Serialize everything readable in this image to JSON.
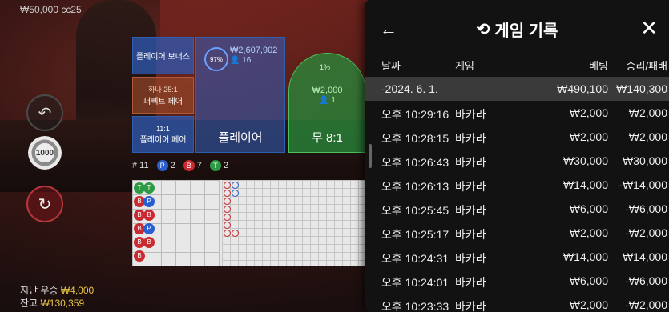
{
  "balance_top": "₩50,000 cc25",
  "chip_value": "1000",
  "bets": {
    "bonus_label": "플레이어 보너스",
    "perfect_line1": "하나 25:1",
    "perfect_line2": "퍼펙트 페어",
    "pair_line1": "11:1",
    "pair_line2": "플레이어 페어",
    "player_label": "플레이어",
    "player_pct": "97%",
    "player_amount": "₩2,607,902",
    "player_people": "16",
    "tie_label": "무 8:1",
    "tie_pct": "1%",
    "tie_amount": "₩2,000",
    "tie_people": "1"
  },
  "stats": {
    "round": "# 11",
    "p_letter": "P",
    "p_count": "2",
    "b_letter": "B",
    "b_count": "7",
    "t_letter": "T",
    "t_count": "2"
  },
  "bottom": {
    "last_win_label": "지난 우승",
    "last_win_value": "₩4,000",
    "balance_label": "잔고",
    "balance_value": "₩130,359"
  },
  "panel": {
    "title": "게임 기록",
    "columns": [
      "날짜",
      "게임",
      "베팅",
      "승리/패배"
    ],
    "date_row": {
      "date": "-2024. 6. 1.",
      "bet": "₩490,100",
      "result": "₩140,300"
    },
    "rows": [
      {
        "time": "오후 10:29:16",
        "game": "바카라",
        "bet": "₩2,000",
        "result": "₩2,000"
      },
      {
        "time": "오후 10:28:15",
        "game": "바카라",
        "bet": "₩2,000",
        "result": "₩2,000"
      },
      {
        "time": "오후 10:26:43",
        "game": "바카라",
        "bet": "₩30,000",
        "result": "₩30,000"
      },
      {
        "time": "오후 10:26:13",
        "game": "바카라",
        "bet": "₩14,000",
        "result": "-₩14,000"
      },
      {
        "time": "오후 10:25:45",
        "game": "바카라",
        "bet": "₩6,000",
        "result": "-₩6,000"
      },
      {
        "time": "오후 10:25:17",
        "game": "바카라",
        "bet": "₩2,000",
        "result": "-₩2,000"
      },
      {
        "time": "오후 10:24:31",
        "game": "바카라",
        "bet": "₩14,000",
        "result": "₩14,000"
      },
      {
        "time": "오후 10:24:01",
        "game": "바카라",
        "bet": "₩6,000",
        "result": "-₩6,000"
      },
      {
        "time": "오후 10:23:33",
        "game": "바카라",
        "bet": "₩2,000",
        "result": "-₩2,000"
      }
    ]
  },
  "bead_road": [
    "T",
    "B",
    "B",
    "B",
    "B",
    "B",
    "T",
    "P",
    "B",
    "P",
    "B"
  ]
}
